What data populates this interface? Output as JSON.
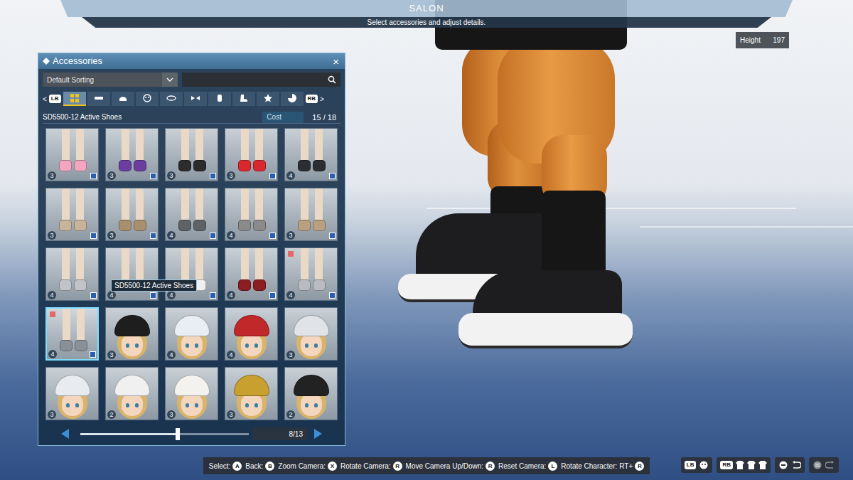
{
  "header": {
    "title": "SALON",
    "subtitle": "Select accessories and adjust details."
  },
  "height": {
    "label": "Height",
    "value": "197"
  },
  "panel": {
    "title": "Accessories",
    "close": "×",
    "sorting": {
      "value": "Default Sorting"
    },
    "tabs": {
      "prev": "<",
      "prev_key": "LB",
      "next_key": "RB",
      "next": ">",
      "items": [
        {
          "selected": true
        },
        {
          "selected": false
        },
        {
          "selected": false
        },
        {
          "selected": false
        },
        {
          "selected": false
        },
        {
          "selected": false
        },
        {
          "selected": false
        },
        {
          "selected": false
        },
        {
          "selected": false
        },
        {
          "selected": false
        }
      ]
    },
    "category": "SD5500-12 Active Shoes",
    "cost": {
      "label": "Cost",
      "value": "15 / 18"
    },
    "items": [
      {
        "kind": "shoes",
        "color": "#f2a6c0",
        "cost": "3",
        "tagged": true,
        "marked": false,
        "selected": false
      },
      {
        "kind": "shoes",
        "color": "#6a3fa0",
        "cost": "3",
        "tagged": true,
        "marked": false,
        "selected": false
      },
      {
        "kind": "shoes",
        "color": "#2c2c2c",
        "cost": "3",
        "tagged": true,
        "marked": false,
        "selected": false
      },
      {
        "kind": "shoes",
        "color": "#d8282e",
        "cost": "3",
        "tagged": true,
        "marked": false,
        "selected": false
      },
      {
        "kind": "shoes",
        "color": "#2a2e33",
        "cost": "4",
        "tagged": true,
        "marked": false,
        "selected": false
      },
      {
        "kind": "shoes",
        "color": "#c8b49a",
        "cost": "3",
        "tagged": true,
        "marked": false,
        "selected": false
      },
      {
        "kind": "shoes",
        "color": "#a8906e",
        "cost": "3",
        "tagged": true,
        "marked": false,
        "selected": false
      },
      {
        "kind": "shoes",
        "color": "#5e6266",
        "cost": "4",
        "tagged": true,
        "marked": false,
        "selected": false
      },
      {
        "kind": "shoes",
        "color": "#8a8a8a",
        "cost": "4",
        "tagged": true,
        "marked": false,
        "selected": false
      },
      {
        "kind": "shoes",
        "color": "#b8a080",
        "cost": "3",
        "tagged": true,
        "marked": false,
        "selected": false
      },
      {
        "kind": "shoes",
        "color": "#c0c4c8",
        "cost": "4",
        "tagged": true,
        "marked": false,
        "selected": false
      },
      {
        "kind": "shoes",
        "color": "#b83030",
        "cost": "4",
        "tagged": true,
        "marked": false,
        "selected": false
      },
      {
        "kind": "shoes",
        "color": "#f0f0f0",
        "cost": "4",
        "tagged": true,
        "marked": false,
        "selected": false
      },
      {
        "kind": "shoes",
        "color": "#8a1e22",
        "cost": "4",
        "tagged": true,
        "marked": false,
        "selected": false
      },
      {
        "kind": "shoes",
        "color": "#b8bcc2",
        "cost": "4",
        "tagged": true,
        "marked": true,
        "selected": false
      },
      {
        "kind": "shoes",
        "color": "#8a9098",
        "cost": "4",
        "tagged": true,
        "marked": true,
        "selected": true
      },
      {
        "kind": "hat",
        "color": "#1e1e1e",
        "cost": "3",
        "tagged": false,
        "marked": false,
        "selected": false
      },
      {
        "kind": "hat",
        "color": "#e8eef4",
        "cost": "4",
        "tagged": false,
        "marked": false,
        "selected": false
      },
      {
        "kind": "hat",
        "color": "#c0282a",
        "cost": "4",
        "tagged": false,
        "marked": false,
        "selected": false
      },
      {
        "kind": "hat",
        "color": "#e0e4e8",
        "cost": "3",
        "tagged": false,
        "marked": false,
        "selected": false
      },
      {
        "kind": "hat",
        "color": "#e8ecf0",
        "cost": "3",
        "tagged": false,
        "marked": false,
        "selected": false
      },
      {
        "kind": "hat",
        "color": "#f0f0f0",
        "cost": "2",
        "tagged": false,
        "marked": false,
        "selected": false
      },
      {
        "kind": "hat",
        "color": "#f4f2ee",
        "cost": "3",
        "tagged": false,
        "marked": false,
        "selected": false
      },
      {
        "kind": "hat",
        "color": "#c8a030",
        "cost": "3",
        "tagged": false,
        "marked": false,
        "selected": false
      },
      {
        "kind": "hat",
        "color": "#222222",
        "cost": "2",
        "tagged": false,
        "marked": false,
        "selected": false
      }
    ],
    "tooltip": "SD5500-12 Active Shoes",
    "pager": {
      "level": 0.58,
      "page": "8/13"
    }
  },
  "controls": [
    {
      "label": "Select:",
      "key": "A"
    },
    {
      "label": "Back:",
      "key": "B"
    },
    {
      "label": "Zoom Camera:",
      "key": "X"
    },
    {
      "label": "Rotate Camera:",
      "key": "R"
    },
    {
      "label": "Move Camera Up/Down:",
      "key": "R"
    },
    {
      "label": "Reset Camera:",
      "key": "L"
    },
    {
      "label": "Rotate Character:",
      "prefix": "RT+",
      "key": "R"
    }
  ],
  "corner_buttons": [
    "LB",
    "RB"
  ]
}
